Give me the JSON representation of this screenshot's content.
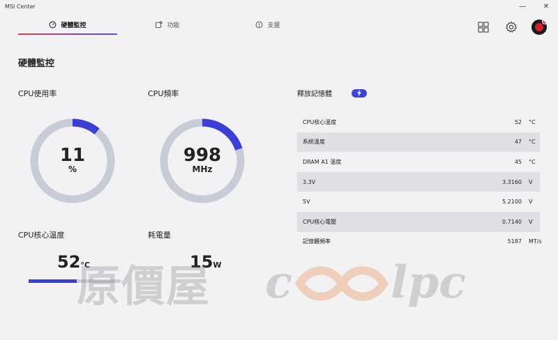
{
  "window": {
    "title": "MSI Center"
  },
  "tabs": [
    {
      "label": "硬體監控"
    },
    {
      "label": "功能"
    },
    {
      "label": "支援"
    }
  ],
  "page_title": "硬體監控",
  "cpu_usage": {
    "label": "CPU使用率",
    "value": "11",
    "unit": "%",
    "fraction": 0.11
  },
  "cpu_freq": {
    "label": "CPU頻率",
    "value": "998",
    "unit": "MHz",
    "fraction": 0.2
  },
  "cpu_temp": {
    "label": "CPU核心溫度",
    "value": "52",
    "unit": "°C",
    "fraction": 0.52
  },
  "power": {
    "label": "耗電量",
    "value": "15",
    "unit": "W"
  },
  "release_memory": {
    "label": "釋放記憶體"
  },
  "stats": [
    {
      "name": "CPU核心溫度",
      "value": "52",
      "unit": "°C"
    },
    {
      "name": "系統溫度",
      "value": "47",
      "unit": "°C"
    },
    {
      "name": "DRAM A1 溫度",
      "value": "45",
      "unit": "°C"
    },
    {
      "name": "3.3V",
      "value": "3.3160",
      "unit": "V"
    },
    {
      "name": "5V",
      "value": "5.2100",
      "unit": "V"
    },
    {
      "name": "CPU核心電壓",
      "value": "0.7140",
      "unit": "V"
    },
    {
      "name": "記憶體頻率",
      "value": "5187",
      "unit": "MT/s"
    }
  ],
  "watermark": {
    "text": "原價屋",
    "logo_text": "coolpc"
  },
  "colors": {
    "accent_blue": "#3b3fd8",
    "accent_red": "#e8344e",
    "gauge_track": "#c8ccd6"
  }
}
